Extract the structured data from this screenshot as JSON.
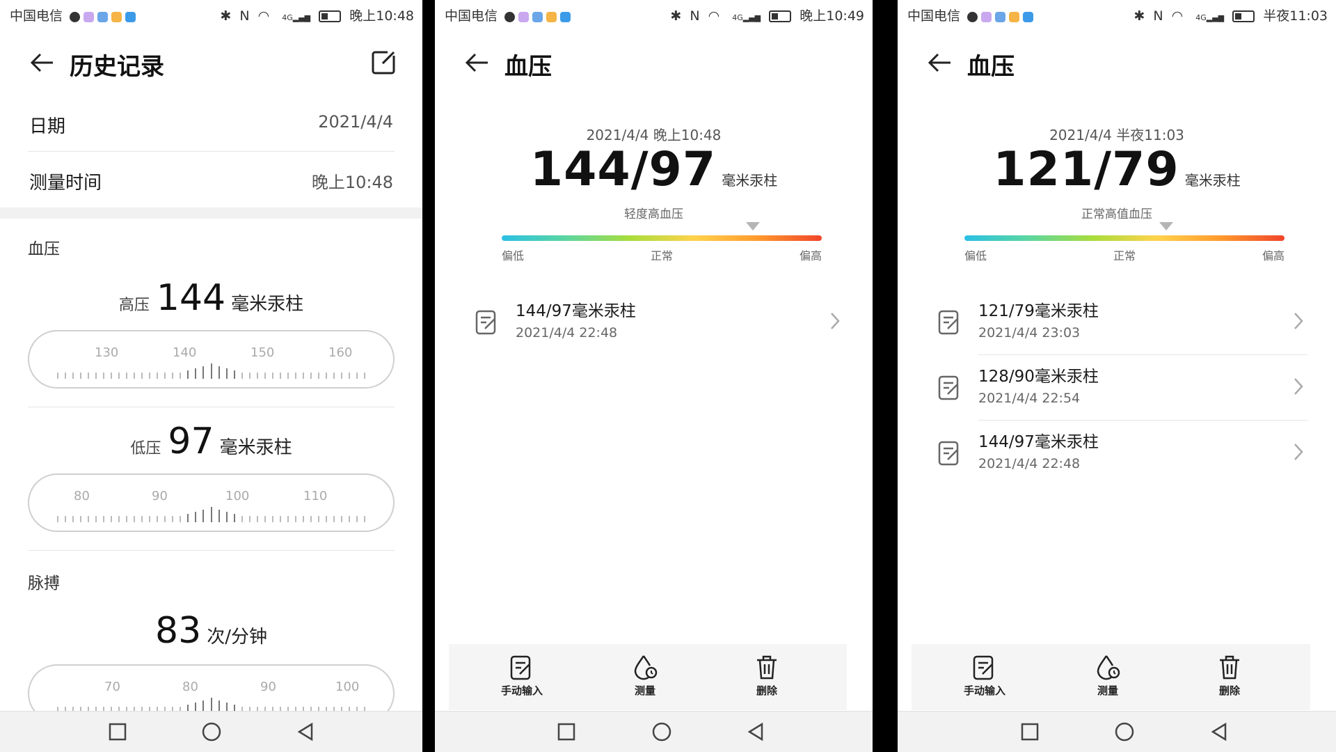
{
  "status_bars": [
    {
      "carrier": "中国电信",
      "time": "晚上10:48"
    },
    {
      "carrier": "中国电信",
      "time": "晚上10:49"
    },
    {
      "carrier": "中国电信",
      "time": "半夜11:03"
    }
  ],
  "status_common": {
    "network": "4G"
  },
  "screen1": {
    "title": "历史记录",
    "date_label": "日期",
    "date_value": "2021/4/4",
    "time_label": "测量时间",
    "time_value": "晚上10:48",
    "bp_section": "血压",
    "systolic": {
      "label": "高压",
      "value": "144",
      "unit": "毫米汞柱",
      "ticks": [
        "130",
        "140",
        "150",
        "160"
      ]
    },
    "diastolic": {
      "label": "低压",
      "value": "97",
      "unit": "毫米汞柱",
      "ticks": [
        "80",
        "90",
        "100",
        "110"
      ]
    },
    "pulse_section": "脉搏",
    "pulse": {
      "value": "83",
      "unit": "次/分钟",
      "ticks": [
        "70",
        "80",
        "90",
        "100"
      ]
    }
  },
  "screen2": {
    "title": "血压",
    "datetime": "2021/4/4 晚上10:48",
    "reading": "144/97",
    "unit": "毫米汞柱",
    "classification": "轻度高血压",
    "scale_labels": [
      "偏低",
      "正常",
      "偏高"
    ],
    "records": [
      {
        "value": "144/97毫米汞柱",
        "date": "2021/4/4  22:48"
      }
    ]
  },
  "screen3": {
    "title": "血压",
    "datetime": "2021/4/4 半夜11:03",
    "reading": "121/79",
    "unit": "毫米汞柱",
    "classification": "正常高值血压",
    "scale_labels": [
      "偏低",
      "正常",
      "偏高"
    ],
    "records": [
      {
        "value": "121/79毫米汞柱",
        "date": "2021/4/4  23:03"
      },
      {
        "value": "128/90毫米汞柱",
        "date": "2021/4/4  22:54"
      },
      {
        "value": "144/97毫米汞柱",
        "date": "2021/4/4  22:48"
      }
    ]
  },
  "actions": {
    "manual": "手动输入",
    "measure": "测量",
    "delete": "删除"
  },
  "colors": {
    "scale_low": "#2bc0e4",
    "scale_normal": "#a8dd3c",
    "scale_high": "#f0452a"
  }
}
